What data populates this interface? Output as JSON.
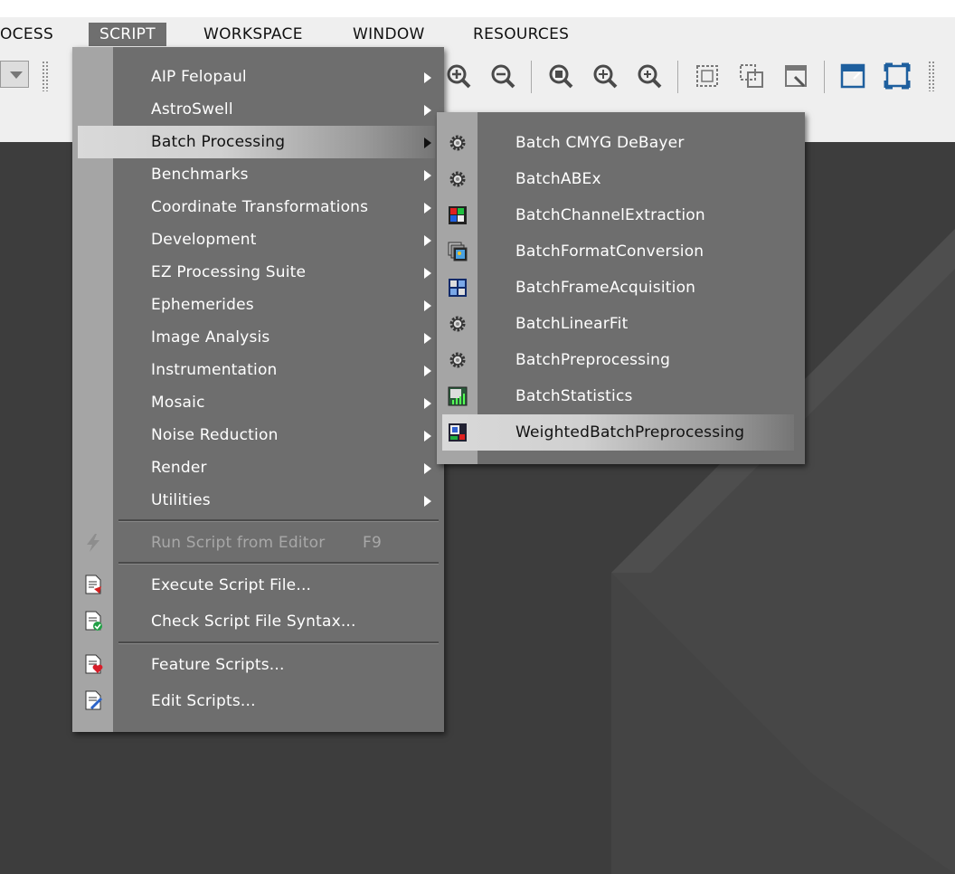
{
  "menubar": {
    "items": [
      {
        "label": "OCESS"
      },
      {
        "label": "SCRIPT"
      },
      {
        "label": "WORKSPACE"
      },
      {
        "label": "WINDOW"
      },
      {
        "label": "RESOURCES"
      }
    ]
  },
  "script_menu": {
    "items": [
      {
        "label": "AIP Felopaul"
      },
      {
        "label": "AstroSwell"
      },
      {
        "label": "Batch Processing"
      },
      {
        "label": "Benchmarks"
      },
      {
        "label": "Coordinate Transformations"
      },
      {
        "label": "Development"
      },
      {
        "label": "EZ Processing Suite"
      },
      {
        "label": "Ephemerides"
      },
      {
        "label": "Image Analysis"
      },
      {
        "label": "Instrumentation"
      },
      {
        "label": "Mosaic"
      },
      {
        "label": "Noise Reduction"
      },
      {
        "label": "Render"
      },
      {
        "label": "Utilities"
      }
    ],
    "run_script": {
      "label": "Run Script from Editor",
      "shortcut": "F9"
    },
    "execute_file": {
      "label": "Execute Script File..."
    },
    "check_syntax": {
      "label": "Check Script File Syntax..."
    },
    "feature_scripts": {
      "label": "Feature Scripts..."
    },
    "edit_scripts": {
      "label": "Edit Scripts..."
    }
  },
  "batch_submenu": {
    "items": [
      {
        "label": "Batch CMYG DeBayer",
        "icon": "gear-icon"
      },
      {
        "label": "BatchABEx",
        "icon": "gear-icon"
      },
      {
        "label": "BatchChannelExtraction",
        "icon": "channel-extraction-icon"
      },
      {
        "label": "BatchFormatConversion",
        "icon": "format-conversion-icon"
      },
      {
        "label": "BatchFrameAcquisition",
        "icon": "frame-acquisition-icon"
      },
      {
        "label": "BatchLinearFit",
        "icon": "gear-icon"
      },
      {
        "label": "BatchPreprocessing",
        "icon": "gear-icon"
      },
      {
        "label": "BatchStatistics",
        "icon": "statistics-icon"
      },
      {
        "label": "WeightedBatchPreprocessing",
        "icon": "weighted-preprocessing-icon"
      }
    ]
  },
  "colors": {
    "menu_bg": "#6e6e6e",
    "gutter": "#a5a5a5",
    "highlight": "#d0d0d0",
    "workspace": "#3d3d3d"
  }
}
